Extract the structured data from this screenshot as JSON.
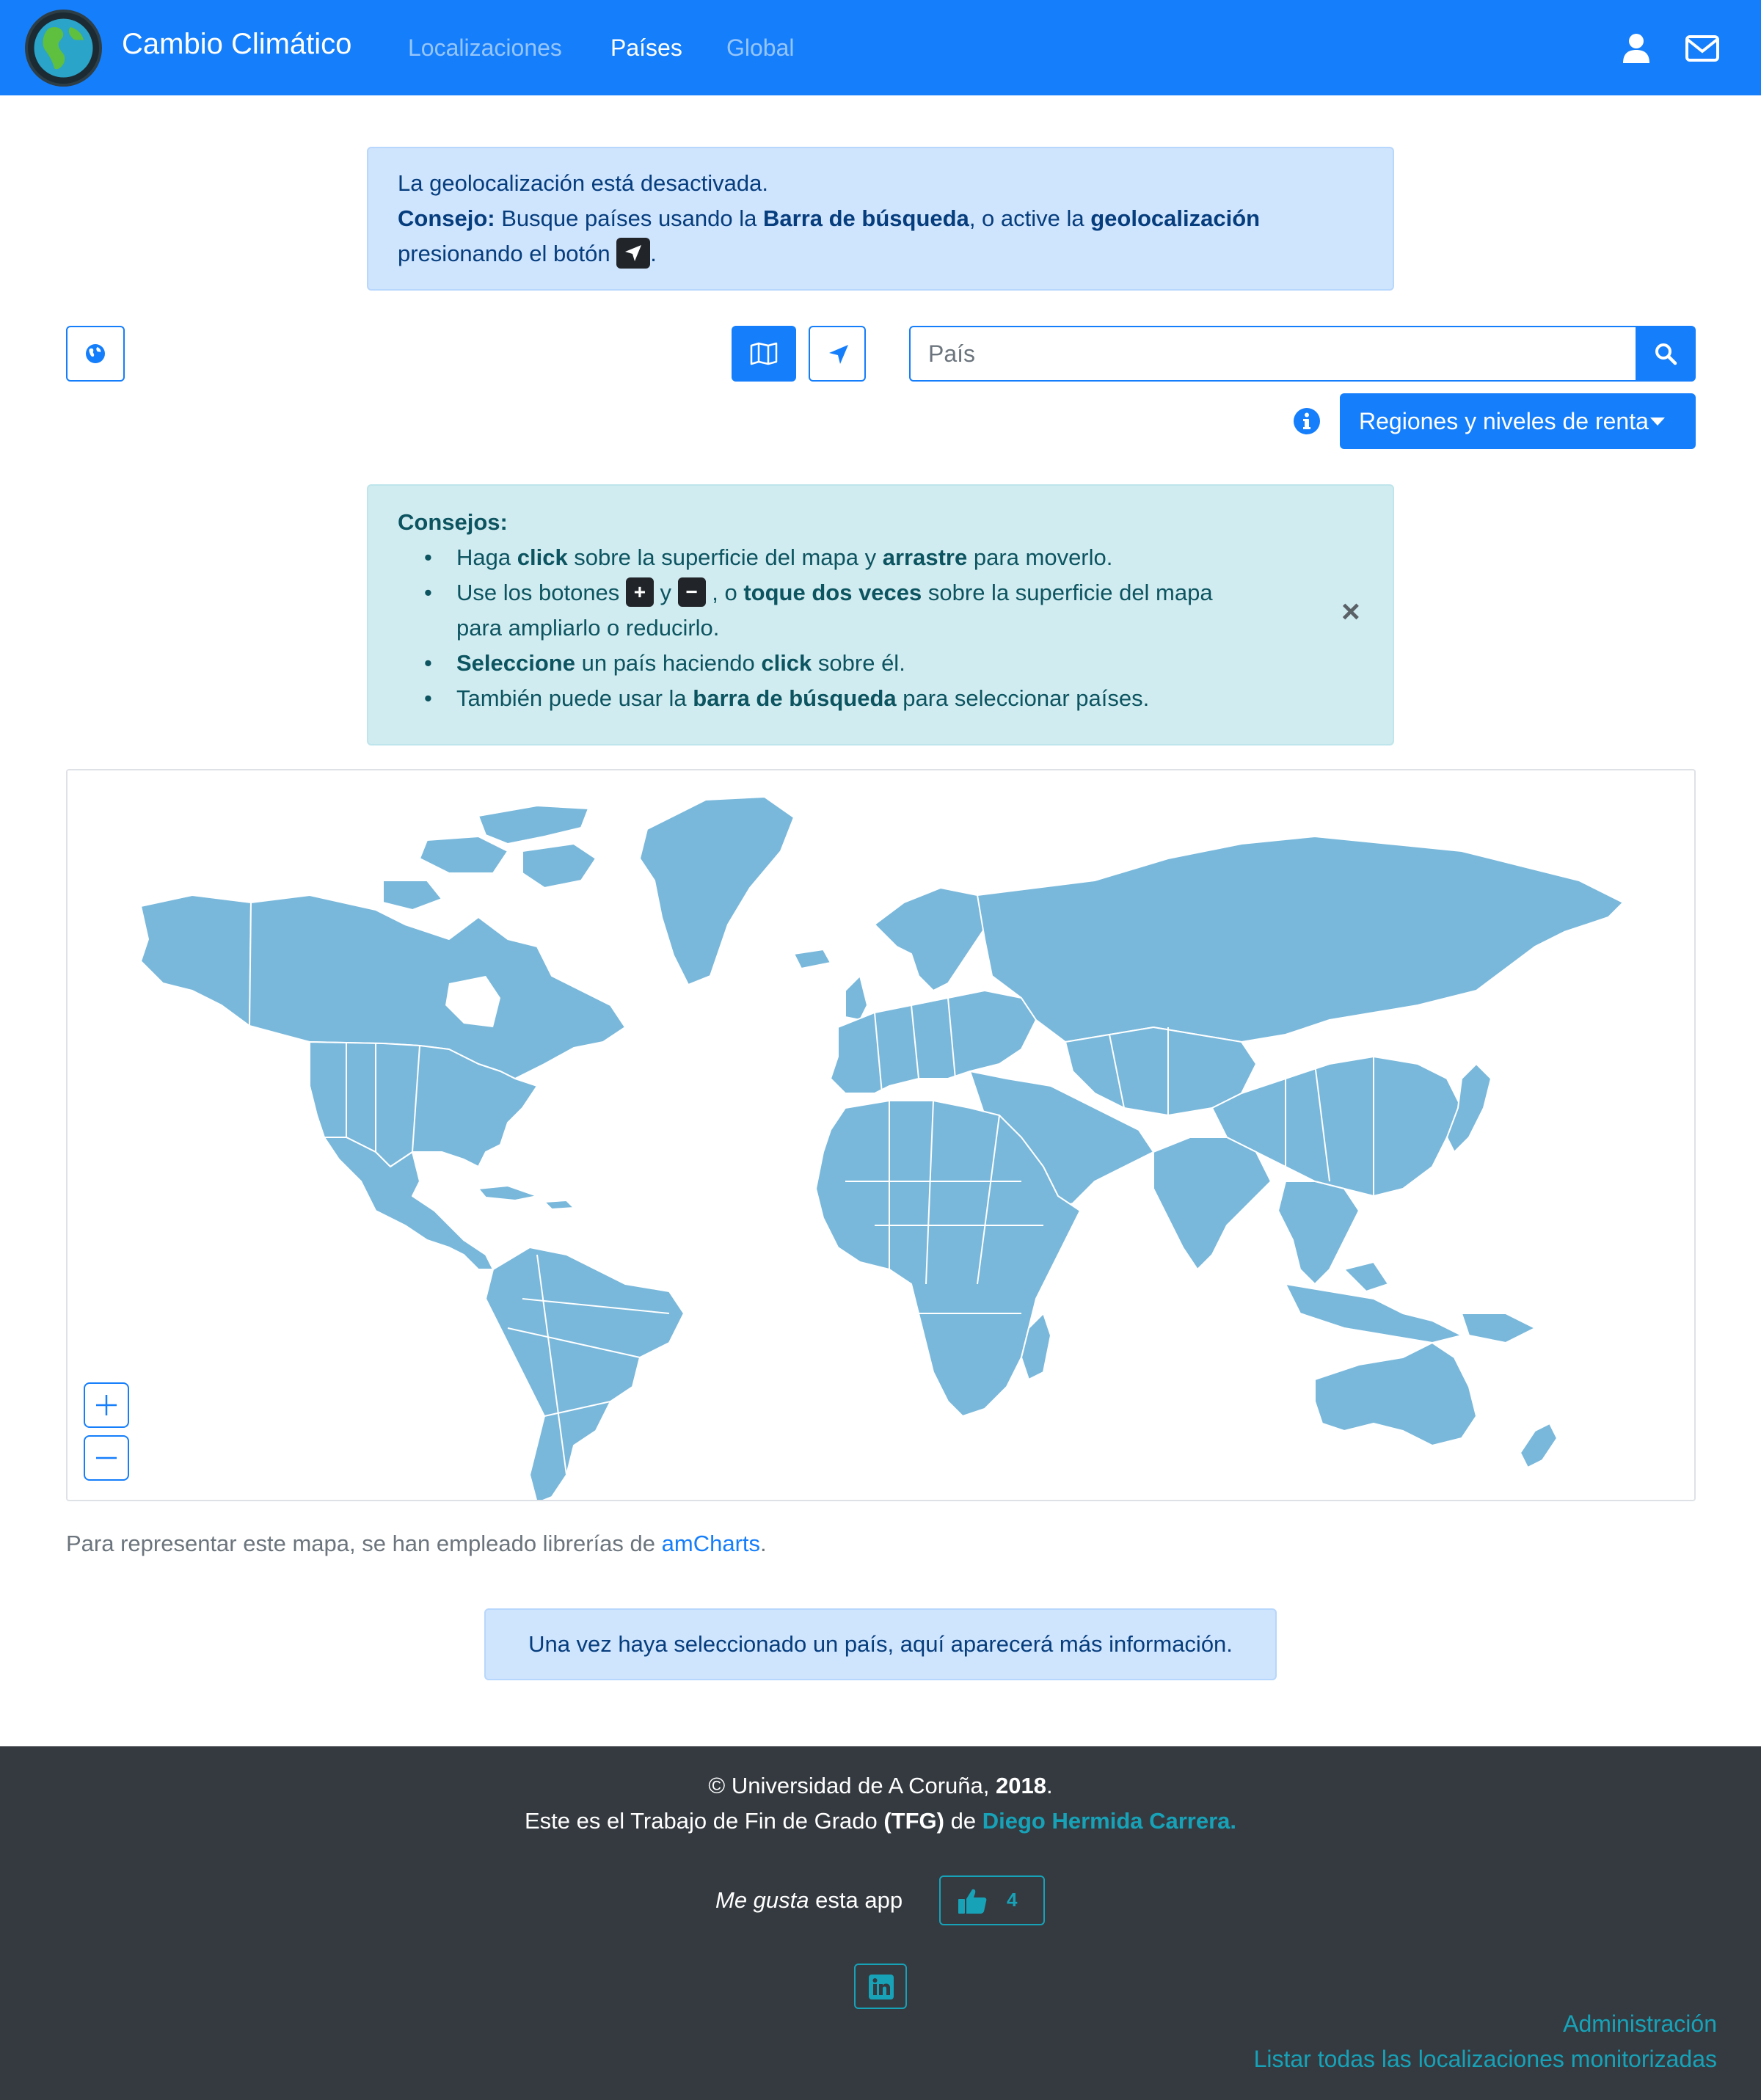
{
  "navbar": {
    "brand": "Cambio Climático",
    "links": [
      {
        "label": "Localizaciones",
        "active": false
      },
      {
        "label": "Países",
        "active": true
      },
      {
        "label": "Global",
        "active": false
      }
    ],
    "icons": [
      "user-icon",
      "envelope-icon"
    ]
  },
  "geo_alert": {
    "line1": "La geolocalización está desactivada.",
    "tip_label": "Consejo:",
    "tip_text1": " Busque países usando la ",
    "tip_bold1": "Barra de búsqueda",
    "tip_text2": ", o active la ",
    "tip_bold2": "geolocalización",
    "line3": "presionando el botón ",
    "line3_end": "."
  },
  "toolbar": {
    "search_placeholder": "País",
    "dropdown_label": "Regiones y niveles de renta",
    "icons": [
      "globe-icon",
      "map-icon",
      "location-arrow-icon",
      "search-icon",
      "info-icon"
    ]
  },
  "tips": {
    "title": "Consejos:",
    "item1": {
      "a": "Haga ",
      "b1": "click",
      "c": " sobre la superficie del mapa y ",
      "b2": "arrastre",
      "d": " para moverlo."
    },
    "item2": {
      "a": "Use los botones ",
      "plus": "+",
      "y": " y ",
      "minus": "−",
      "c": " , o ",
      "b1": "toque dos veces",
      "d": " sobre la superficie del mapa",
      "e": "para ampliarlo o reducirlo."
    },
    "item3": {
      "b1": "Seleccione",
      "a": " un país haciendo ",
      "b2": "click",
      "c": " sobre él."
    },
    "item4": {
      "a": "También puede usar la ",
      "b1": "barra de búsqueda",
      "c": " para seleccionar países."
    },
    "close": "×"
  },
  "map": {
    "land_color": "#79b8db",
    "border_color": "#ffffff",
    "zoom_in": "+",
    "zoom_out": "−"
  },
  "credit": {
    "text": "Para representar este mapa, se han empleado librerías de ",
    "link": "amCharts",
    "end": "."
  },
  "info_alert": {
    "text": "Una vez haya seleccionado un país, aquí aparecerá más información."
  },
  "footer": {
    "copyright_a": "© Universidad de A Coruña, ",
    "copyright_year": "2018",
    "copyright_end": ".",
    "tfg_a": "Este es el Trabajo de Fin de Grado ",
    "tfg_b": "(TFG)",
    "tfg_c": " de ",
    "author": "Diego Hermida Carrera.",
    "like_a": "Me gusta",
    "like_b": " esta app",
    "like_count": "4",
    "admin_link": "Administración",
    "list_link": "Listar todas las localizaciones monitorizadas"
  },
  "colors": {
    "primary": "#157efb",
    "footer_bg": "#343a40",
    "teal": "#17a2b8"
  }
}
